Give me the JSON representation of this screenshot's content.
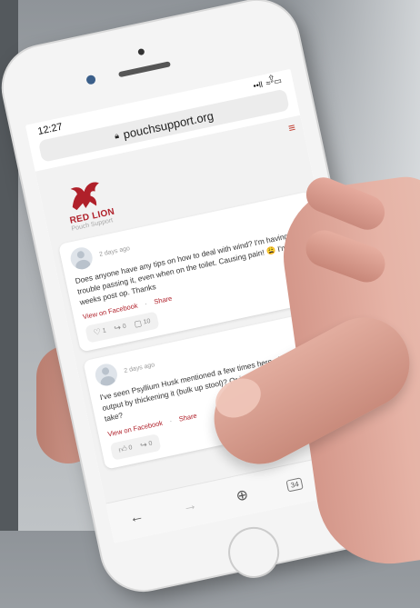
{
  "status": {
    "time": "12:27",
    "signal": "••ll",
    "wifi": "≈",
    "battery": "▭"
  },
  "browser": {
    "url": "pouchsupport.org",
    "tabs_count": "34"
  },
  "brand": {
    "name": "RED LION",
    "subtitle": "Pouch Support"
  },
  "posts": [
    {
      "time": "2 days ago",
      "text": "Does anyone have any tips on how to deal with wind? I'm having trouble passing it, even when on the toilet. Causing pain! 😩 I'm 8 weeks post op. Thanks",
      "view_label": "View on Facebook",
      "share_label": "Share",
      "likes": "1",
      "shares": "0",
      "comments": "10"
    },
    {
      "time": "2 days ago",
      "text": "I've seen Psyllium Husk mentioned a few times here. does it reduce output by thickening it (bulk up stool)? Or is there a specific which to take?",
      "view_label": "View on Facebook",
      "share_label": "Share",
      "likes": "0",
      "shares": "0",
      "comments": ""
    }
  ],
  "colors": {
    "accent": "#b0202a",
    "menu": "#c0392b"
  }
}
